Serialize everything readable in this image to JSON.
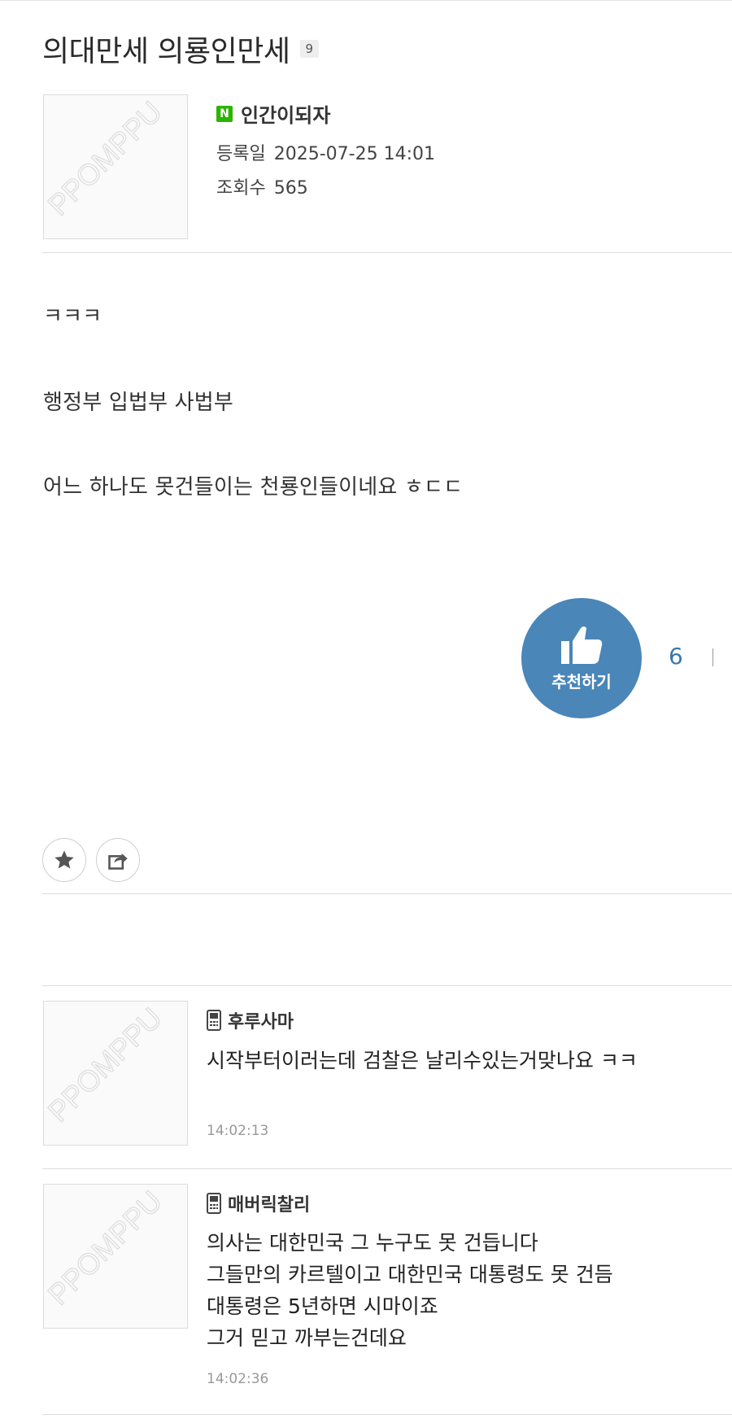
{
  "post": {
    "title": "의대만세 의룡인만세",
    "comment_count": "9",
    "author": {
      "badge": "N",
      "name": "인간이되자"
    },
    "registered_label": "등록일",
    "registered_value": "2025-07-25 14:01",
    "views_label": "조회수",
    "views_value": "565",
    "body": [
      "ㅋㅋㅋ",
      "행정부 입법부 사법부",
      "어느 하나도 못건들이는 천룡인들이네요 ㅎㄷㄷ"
    ]
  },
  "recommend": {
    "label": "추천하기",
    "count": "6"
  },
  "actions": {
    "favorite_icon": "star-icon",
    "share_icon": "share-icon"
  },
  "comments": [
    {
      "author": "후루사마",
      "device_icon": "mobile-phone-icon",
      "lines": [
        "시작부터이러는데 검찰은 날리수있는거맞나요 ㅋㅋ"
      ],
      "time": "14:02:13"
    },
    {
      "author": "매버릭찰리",
      "device_icon": "mobile-phone-icon",
      "lines": [
        "의사는 대한민국 그 누구도 못 건듭니다",
        "그들만의 카르텔이고 대한민국 대통령도 못 건듬",
        "대통령은 5년하면 시마이죠",
        "그거 믿고 까부는건데요"
      ],
      "time": "14:02:36"
    }
  ],
  "colors": {
    "accent": "#4a86b8",
    "naver_green": "#2db400"
  }
}
